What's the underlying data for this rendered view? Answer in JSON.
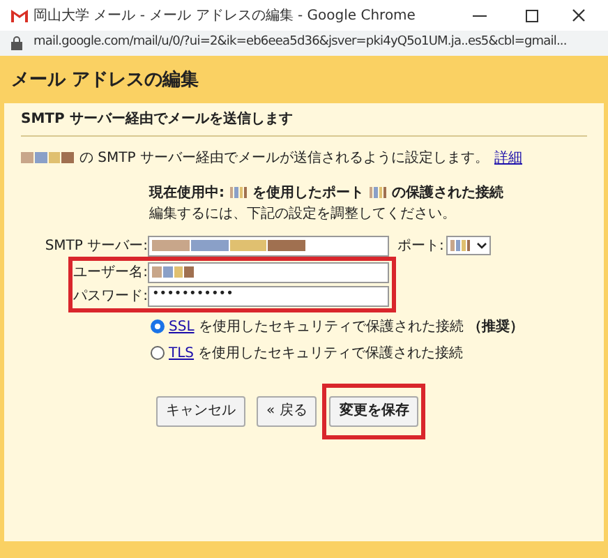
{
  "window": {
    "title": "岡山大学 メール - メール アドレスの編集 - Google Chrome",
    "url": "mail.google.com/mail/u/0/?ui=2&ik=eb6eea5d36&jsver=pki4yQ5o1UM.ja..es5&cbl=gmail..."
  },
  "dialog": {
    "title": "メール アドレスの編集",
    "subtitle": "SMTP サーバー経由でメールを送信します",
    "intro": "の SMTP サーバー経由でメールが送信されるように設定します。",
    "intro_link": "詳細",
    "current_a": "現在使用中:",
    "current_b": "を使用したポート",
    "current_c": "の保護された接続",
    "current_hint": "編集するには、下記の設定を調整してください。",
    "fields": [
      {
        "label": "SMTP サーバー:",
        "kind": "redacted",
        "highlighted": false
      },
      {
        "label": "ユーザー名:",
        "kind": "redacted",
        "highlighted": true
      },
      {
        "label": "パスワード:",
        "kind": "password",
        "value": "•••••••••••",
        "highlighted": true
      }
    ],
    "port_label": "ポート:",
    "security": [
      {
        "link": "SSL",
        "text": "を使用したセキュリティで保護された接続",
        "note": "（推奨）",
        "selected": true
      },
      {
        "link": "TLS",
        "text": "を使用したセキュリティで保護された接続",
        "selected": false
      }
    ],
    "buttons": [
      {
        "label": "キャンセル",
        "highlighted": false,
        "primary": false
      },
      {
        "label": "« 戻る",
        "highlighted": false,
        "primary": false
      },
      {
        "label": "変更を保存",
        "highlighted": true,
        "primary": true
      }
    ]
  }
}
